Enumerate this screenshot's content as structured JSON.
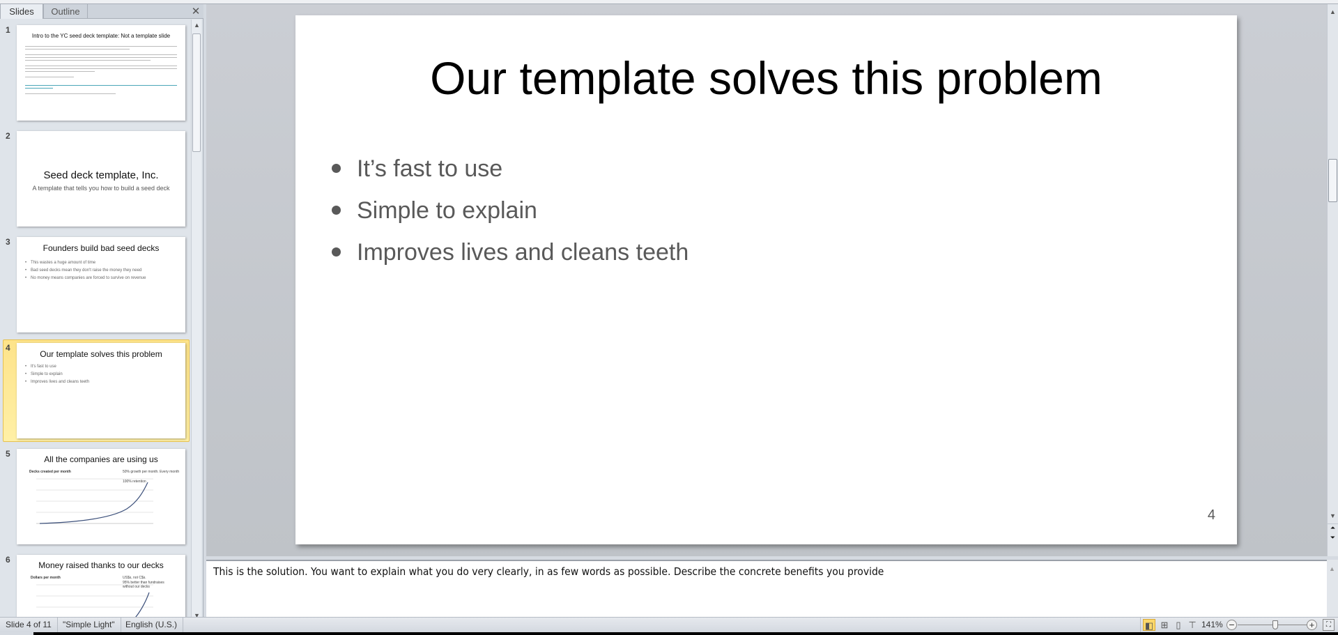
{
  "panel": {
    "tabs": [
      {
        "label": "Slides",
        "active": true
      },
      {
        "label": "Outline",
        "active": false
      }
    ],
    "close_icon": "close-icon"
  },
  "thumbnails": [
    {
      "num": "1",
      "title": "Intro to the YC seed deck template:  Not a template slide"
    },
    {
      "num": "2",
      "title": "Seed deck template,  Inc.",
      "subtitle": "A template that tells you how to build a seed deck"
    },
    {
      "num": "3",
      "title": "Founders build bad seed decks",
      "bullets": [
        "This wastes a huge amount of time",
        "Bad seed decks mean they don't raise the money they need",
        "No money means companies are forced to survive on revenue"
      ]
    },
    {
      "num": "4",
      "title": "Our template solves this problem",
      "bullets": [
        "It's fast to use",
        "Simple to explain",
        "Improves lives and cleans teeth"
      ],
      "selected": true
    },
    {
      "num": "5",
      "title": "All the companies are using us",
      "chart_label": "Decks created per month",
      "notes": [
        "50% growth per month. Every month",
        "100% retention"
      ]
    },
    {
      "num": "6",
      "title": "Money raised thanks to our decks",
      "chart_label": "Dollars per month",
      "notes": [
        "US$s, not C$s.",
        "95% better than fundraises without our decks"
      ]
    }
  ],
  "slide": {
    "title": "Our template solves this problem",
    "bullets": [
      "It’s fast to use",
      "Simple to explain",
      "Improves lives and cleans teeth"
    ],
    "number": "4"
  },
  "notes": {
    "text": "This is the solution. You want to explain what you do very clearly, in as few words as possible. Describe the concrete benefits you provide"
  },
  "status": {
    "slide": "Slide 4 of 11",
    "theme": "\"Simple Light\"",
    "language": "English (U.S.)",
    "zoom": "141%",
    "zoom_level_percent": 141,
    "active_view": "normal"
  },
  "colors": {
    "selection": "#fde38a",
    "bullet_text": "#595959"
  }
}
